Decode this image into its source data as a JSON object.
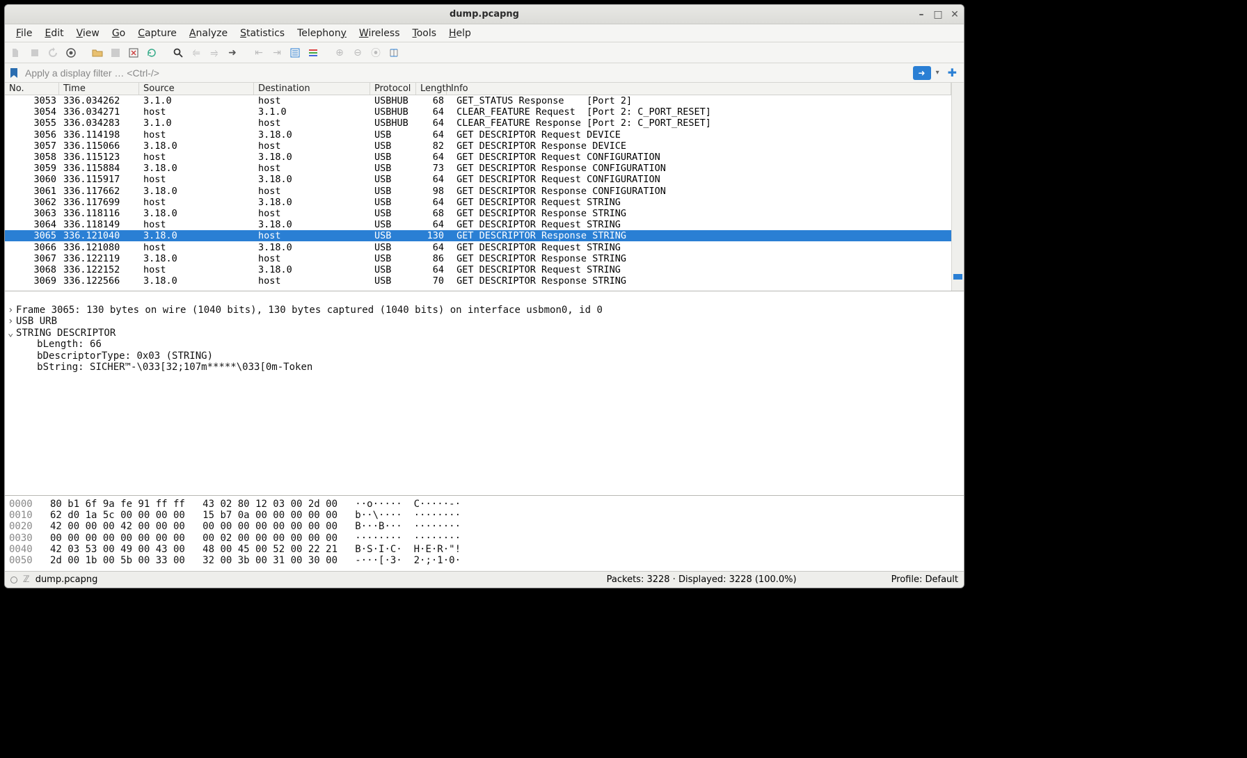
{
  "window": {
    "title": "dump.pcapng"
  },
  "menu": [
    "File",
    "Edit",
    "View",
    "Go",
    "Capture",
    "Analyze",
    "Statistics",
    "Telephony",
    "Wireless",
    "Tools",
    "Help"
  ],
  "filter": {
    "placeholder": "Apply a display filter … <Ctrl-/>"
  },
  "columns": {
    "no": "No.",
    "time": "Time",
    "src": "Source",
    "dst": "Destination",
    "proto": "Protocol",
    "len": "Length",
    "info": "Info"
  },
  "packets": [
    {
      "no": "3053",
      "time": "336.034262",
      "src": "3.1.0",
      "dst": "host",
      "proto": "USBHUB",
      "len": "68",
      "info": "GET_STATUS Response    [Port 2]"
    },
    {
      "no": "3054",
      "time": "336.034271",
      "src": "host",
      "dst": "3.1.0",
      "proto": "USBHUB",
      "len": "64",
      "info": "CLEAR_FEATURE Request  [Port 2: C_PORT_RESET]"
    },
    {
      "no": "3055",
      "time": "336.034283",
      "src": "3.1.0",
      "dst": "host",
      "proto": "USBHUB",
      "len": "64",
      "info": "CLEAR_FEATURE Response [Port 2: C_PORT_RESET]"
    },
    {
      "no": "3056",
      "time": "336.114198",
      "src": "host",
      "dst": "3.18.0",
      "proto": "USB",
      "len": "64",
      "info": "GET DESCRIPTOR Request DEVICE"
    },
    {
      "no": "3057",
      "time": "336.115066",
      "src": "3.18.0",
      "dst": "host",
      "proto": "USB",
      "len": "82",
      "info": "GET DESCRIPTOR Response DEVICE"
    },
    {
      "no": "3058",
      "time": "336.115123",
      "src": "host",
      "dst": "3.18.0",
      "proto": "USB",
      "len": "64",
      "info": "GET DESCRIPTOR Request CONFIGURATION"
    },
    {
      "no": "3059",
      "time": "336.115884",
      "src": "3.18.0",
      "dst": "host",
      "proto": "USB",
      "len": "73",
      "info": "GET DESCRIPTOR Response CONFIGURATION"
    },
    {
      "no": "3060",
      "time": "336.115917",
      "src": "host",
      "dst": "3.18.0",
      "proto": "USB",
      "len": "64",
      "info": "GET DESCRIPTOR Request CONFIGURATION"
    },
    {
      "no": "3061",
      "time": "336.117662",
      "src": "3.18.0",
      "dst": "host",
      "proto": "USB",
      "len": "98",
      "info": "GET DESCRIPTOR Response CONFIGURATION"
    },
    {
      "no": "3062",
      "time": "336.117699",
      "src": "host",
      "dst": "3.18.0",
      "proto": "USB",
      "len": "64",
      "info": "GET DESCRIPTOR Request STRING"
    },
    {
      "no": "3063",
      "time": "336.118116",
      "src": "3.18.0",
      "dst": "host",
      "proto": "USB",
      "len": "68",
      "info": "GET DESCRIPTOR Response STRING"
    },
    {
      "no": "3064",
      "time": "336.118149",
      "src": "host",
      "dst": "3.18.0",
      "proto": "USB",
      "len": "64",
      "info": "GET DESCRIPTOR Request STRING"
    },
    {
      "no": "3065",
      "time": "336.121040",
      "src": "3.18.0",
      "dst": "host",
      "proto": "USB",
      "len": "130",
      "info": "GET DESCRIPTOR Response STRING",
      "selected": true
    },
    {
      "no": "3066",
      "time": "336.121080",
      "src": "host",
      "dst": "3.18.0",
      "proto": "USB",
      "len": "64",
      "info": "GET DESCRIPTOR Request STRING"
    },
    {
      "no": "3067",
      "time": "336.122119",
      "src": "3.18.0",
      "dst": "host",
      "proto": "USB",
      "len": "86",
      "info": "GET DESCRIPTOR Response STRING"
    },
    {
      "no": "3068",
      "time": "336.122152",
      "src": "host",
      "dst": "3.18.0",
      "proto": "USB",
      "len": "64",
      "info": "GET DESCRIPTOR Request STRING"
    },
    {
      "no": "3069",
      "time": "336.122566",
      "src": "3.18.0",
      "dst": "host",
      "proto": "USB",
      "len": "70",
      "info": "GET DESCRIPTOR Response STRING"
    }
  ],
  "details": {
    "l1": "Frame 3065: 130 bytes on wire (1040 bits), 130 bytes captured (1040 bits) on interface usbmon0, id 0",
    "l2": "USB URB",
    "l3": "STRING DESCRIPTOR",
    "l4": "bLength: 66",
    "l5": "bDescriptorType: 0x03 (STRING)",
    "l6": "bString: SICHER™-\\033[32;107m*****\\033[0m-Token"
  },
  "hex": [
    {
      "off": "0000",
      "h": "80 b1 6f 9a fe 91 ff ff   43 02 80 12 03 00 2d 00",
      "a": "··o·····  C·····-·"
    },
    {
      "off": "0010",
      "h": "62 d0 1a 5c 00 00 00 00   15 b7 0a 00 00 00 00 00",
      "a": "b··\\····  ········"
    },
    {
      "off": "0020",
      "h": "42 00 00 00 42 00 00 00   00 00 00 00 00 00 00 00",
      "a": "B···B···  ········"
    },
    {
      "off": "0030",
      "h": "00 00 00 00 00 00 00 00   00 02 00 00 00 00 00 00",
      "a": "········  ········"
    },
    {
      "off": "0040",
      "h": "42 03 53 00 49 00 43 00   48 00 45 00 52 00 22 21",
      "a": "B·S·I·C·  H·E·R·\"!"
    },
    {
      "off": "0050",
      "h": "2d 00 1b 00 5b 00 33 00   32 00 3b 00 31 00 30 00",
      "a": "-···[·3·  2·;·1·0·"
    }
  ],
  "status": {
    "file": "dump.pcapng",
    "packets": "Packets: 3228 · Displayed: 3228 (100.0%)",
    "profile": "Profile: Default"
  }
}
